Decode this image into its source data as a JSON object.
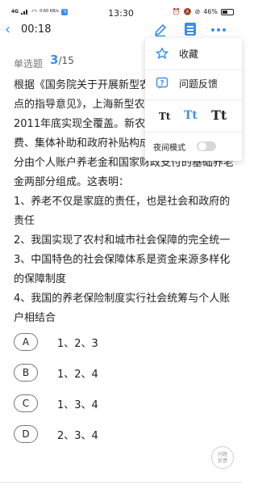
{
  "status_bar": {
    "network": "4G",
    "net_speed": "0.60 KB/s",
    "app_badge": "飞",
    "time": "13:30",
    "battery_percent": "46%"
  },
  "topbar": {
    "timer": "00:18"
  },
  "question": {
    "type": "单选题",
    "current": "3",
    "total": "/15",
    "stem": "根据《国务院关于开展新型农村社会养老保险试点的指导意见》，上海新型农村社会养老保险于2011年底实现全覆盖。新农保基金由个人缴费、集体补助和政府补贴构成，养老金待遇由部分由个人账户养老金和国家财政支付的基础养老金两部分组成。这表明：\n1、养老不仅是家庭的责任，也是社会和政府的责任\n2、我国实现了农村和城市社会保障的完全统一\n3、中国特色的社会保障体系是资金来源多样化的保障制度\n4、我国的养老保险制度实行社会统筹与个人账户相结合",
    "options": [
      {
        "letter": "A",
        "text": "1、2、3"
      },
      {
        "letter": "B",
        "text": "1、2、4"
      },
      {
        "letter": "C",
        "text": "1、3、4"
      },
      {
        "letter": "D",
        "text": "2、3、4"
      }
    ]
  },
  "feedback_fab": {
    "line1": "问题",
    "line2": "反馈"
  },
  "menu": {
    "favorite_label": "收藏",
    "feedback_label": "问题反馈",
    "font_small": "Tt",
    "font_medium": "Tt",
    "font_large": "Tt",
    "night_mode_label": "夜间模式",
    "night_mode_on": false
  },
  "colors": {
    "accent": "#3b8df2",
    "text": "#222222",
    "muted": "#777777"
  }
}
